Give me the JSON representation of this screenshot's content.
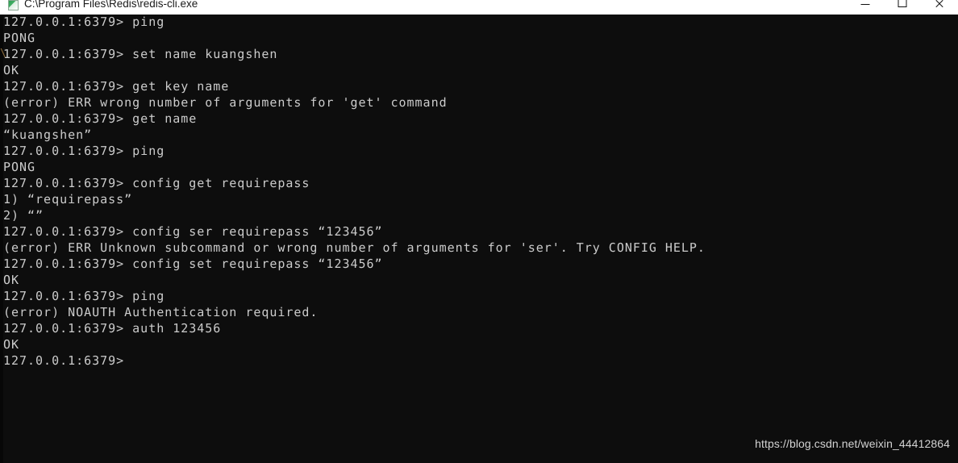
{
  "window": {
    "title": "C:\\Program Files\\Redis\\redis-cli.exe",
    "icon": "console-app-icon",
    "background_color": "#0d0d0d",
    "titlebar_color": "#ffffff",
    "text_color": "#cccccc",
    "controls": {
      "minimize_label": "—",
      "maximize_label": "□",
      "close_label": "✕"
    }
  },
  "terminal": {
    "prompt": "127.0.0.1:6379>",
    "font_size_px": 15,
    "line_height_px": 20,
    "lines": [
      "127.0.0.1:6379> ping",
      "PONG",
      "127.0.0.1:6379> set name kuangshen",
      "OK",
      "127.0.0.1:6379> get key name",
      "(error) ERR wrong number of arguments for 'get' command",
      "127.0.0.1:6379> get name",
      "“kuangshen”",
      "127.0.0.1:6379> ping",
      "PONG",
      "127.0.0.1:6379> config get requirepass",
      "1) “requirepass”",
      "2) “”",
      "127.0.0.1:6379> config ser requirepass “123456”",
      "(error) ERR Unknown subcommand or wrong number of arguments for 'ser'. Try CONFIG HELP.",
      "127.0.0.1:6379> config set requirepass “123456”",
      "OK",
      "127.0.0.1:6379> ping",
      "(error) NOAUTH Authentication required.",
      "127.0.0.1:6379> auth 123456",
      "OK",
      "127.0.0.1:6379>"
    ],
    "caret_artifact": "\\"
  },
  "watermark": {
    "text": "https://blog.csdn.net/weixin_44412864"
  }
}
